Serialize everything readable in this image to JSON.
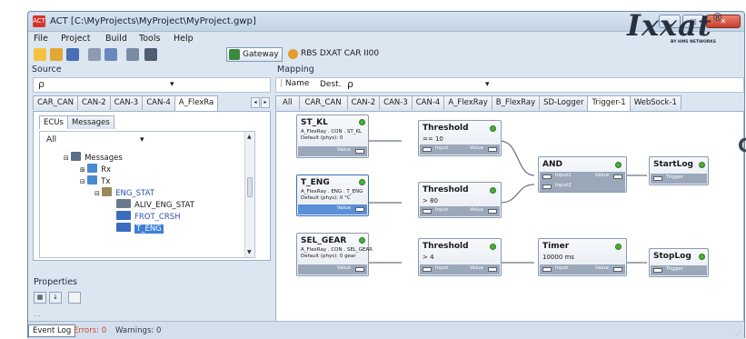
{
  "window": {
    "title": "ACT [C:\\MyProjects\\MyProject\\MyProject.gwp]",
    "app_icon_text": "ACT",
    "controls": {
      "minimize": "▁",
      "maximize": "□",
      "close": "✕"
    }
  },
  "menu": [
    "File",
    "Project",
    "Build",
    "Tools",
    "Help"
  ],
  "toolbar": {
    "icons": [
      "new-icon",
      "open-icon",
      "save-icon",
      "cut-icon",
      "paste-icon",
      "window-icon",
      "layout-icon"
    ],
    "gateway_label": "Gateway",
    "rbs_label": "RBS DXAT CAR II00"
  },
  "brand": {
    "logo": "Ixxat",
    "registered": "®",
    "subtitle": "BY HMS NETWORKS"
  },
  "source": {
    "label": "Source",
    "search_glyph": "ρ",
    "dropdown_mark": "▾",
    "tabs": [
      "CAR_CAN",
      "CAN-2",
      "CAN-3",
      "CAN-4",
      "A_FlexRa"
    ],
    "active_tab": "A_FlexRa",
    "sub_tabs": [
      "ECUs",
      "Messages"
    ],
    "filter_value": "All",
    "tree": [
      {
        "label": "Messages",
        "indent": 0,
        "icon": "folder-icon"
      },
      {
        "label": "Rx",
        "indent": 1,
        "icon": "rx-icon"
      },
      {
        "label": "Tx",
        "indent": 1,
        "icon": "tx-icon"
      },
      {
        "label": "ENG_STAT",
        "indent": 2,
        "icon": "message-icon",
        "style": "blue"
      },
      {
        "label": "ALIV_ENG_STAT",
        "indent": 3,
        "icon": "signal-icon"
      },
      {
        "label": "FROT_CRSH",
        "indent": 3,
        "icon": "signal-icon",
        "style": "blue"
      },
      {
        "label": "T_ENG",
        "indent": 3,
        "icon": "signal-icon",
        "style": "selected"
      }
    ]
  },
  "properties": {
    "label": "Properties",
    "cut_text": "..."
  },
  "mapping": {
    "label": "Mapping",
    "search": {
      "name_label": "Name",
      "dest_label": "Dest.",
      "search_glyph": "ρ",
      "dropdown_mark": "▾"
    },
    "tabs": [
      "All",
      "CAR_CAN",
      "CAN-2",
      "CAN-3",
      "CAN-4",
      "A_FlexRay",
      "B_FlexRay",
      "SD-Logger",
      "Trigger-1",
      "WebSock-1"
    ],
    "active_tab": "Trigger-1",
    "nodes": {
      "st_kl": {
        "title": "ST_KL",
        "desc1": "A_FlexRay . CON . ST_KL",
        "desc2": "Default (phys): 0",
        "port": "Value"
      },
      "t_eng": {
        "title": "T_ENG",
        "desc1": "A_FlexRay . ENG . T_ENG",
        "desc2": "Default (phys): 0 °C",
        "port": "Value"
      },
      "sel_gear": {
        "title": "SEL_GEAR",
        "desc1": "A_FlexRay . CON . SEL_GEAR",
        "desc2": "Default (phys): 0 gear",
        "port": "Value"
      },
      "thr1": {
        "title": "Threshold",
        "sub": "== 10",
        "in": "Input",
        "out": "Value"
      },
      "thr2": {
        "title": "Threshold",
        "sub": "> 80",
        "in": "Input",
        "out": "Value"
      },
      "thr3": {
        "title": "Threshold",
        "sub": "> 4",
        "in": "Input",
        "out": "Value"
      },
      "and": {
        "title": "AND",
        "in1": "Input1",
        "in2": "Input2",
        "out": "Value"
      },
      "timer": {
        "title": "Timer",
        "sub": "10000 ms",
        "in": "Input",
        "out": "Value"
      },
      "startlog": {
        "title": "StartLog",
        "in": "Trigger"
      },
      "stoplog": {
        "title": "StopLog",
        "in": "Trigger"
      }
    }
  },
  "status": {
    "tab": "Event Log",
    "errors": "Errors: 0",
    "warnings": "Warnings: 0"
  },
  "colors": {
    "led_green": "#4caf35",
    "selection_blue": "#3d7fd6",
    "error_red": "#cc4a3a"
  }
}
